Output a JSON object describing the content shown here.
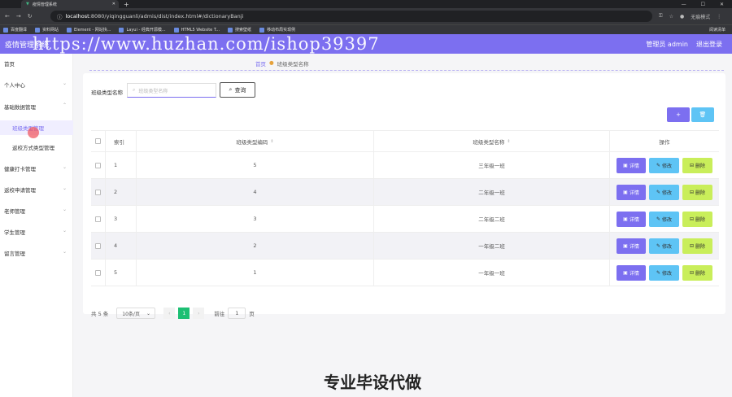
{
  "browser": {
    "tab_title": "疫情管理系统",
    "url_host": "localhost",
    "url_rest": ":8080/yiqingguanli/admis/dist/index.html#/dictionaryBanji",
    "profile": "无痕模式",
    "bookmarks": [
      "百度翻译",
      "资料网站",
      "Element - 网站快...",
      "Layui - 经典开源模...",
      "HTML5 Website T...",
      "搜索壁纸",
      "移动布局实现例"
    ],
    "reading_list": "阅读清单"
  },
  "watermark": "https://www.huzhan.com/ishop39397",
  "header": {
    "logo": "疫情管理系统",
    "admin": "管理员 admin",
    "logout": "退出登录"
  },
  "sidebar": {
    "items": [
      {
        "label": "首页",
        "chev": false
      },
      {
        "label": "个人中心",
        "chev": true
      },
      {
        "label": "基础数据管理",
        "chev": true
      },
      {
        "label": "健康打卡管理",
        "chev": true
      },
      {
        "label": "返校申请管理",
        "chev": true
      },
      {
        "label": "老师管理",
        "chev": true
      },
      {
        "label": "学生管理",
        "chev": true
      },
      {
        "label": "留言管理",
        "chev": true
      }
    ],
    "sub_items": [
      "班级类型管理",
      "返校方式类型管理"
    ]
  },
  "breadcrumb": {
    "home": "首页",
    "current": "班级类型名称"
  },
  "search": {
    "label": "班级类型名称",
    "placeholder": "班级类型名称",
    "button": "查询"
  },
  "actions": {
    "add": "+",
    "delete": "🗑"
  },
  "table": {
    "headers": [
      "索引",
      "班级类型编码",
      "班级类型名称",
      "操作"
    ],
    "rows": [
      {
        "index": "1",
        "code": "5",
        "name": "三年级一班"
      },
      {
        "index": "2",
        "code": "4",
        "name": "二年级一班"
      },
      {
        "index": "3",
        "code": "3",
        "name": "二年级二班"
      },
      {
        "index": "4",
        "code": "2",
        "name": "一年级二班"
      },
      {
        "index": "5",
        "code": "1",
        "name": "一年级一班"
      }
    ],
    "row_buttons": {
      "detail": "详情",
      "edit": "修改",
      "delete": "删除"
    }
  },
  "pagination": {
    "total": "共 5 条",
    "page_size": "10条/页",
    "current": "1",
    "goto": "前往",
    "goto_value": "1",
    "page_suffix": "页"
  },
  "bottom_caption": "专业毕设代做",
  "colors": {
    "accent": "#7c6ff0",
    "info": "#5ec4f5",
    "lime": "#c9ee5a",
    "page_active": "#1dbf73"
  }
}
